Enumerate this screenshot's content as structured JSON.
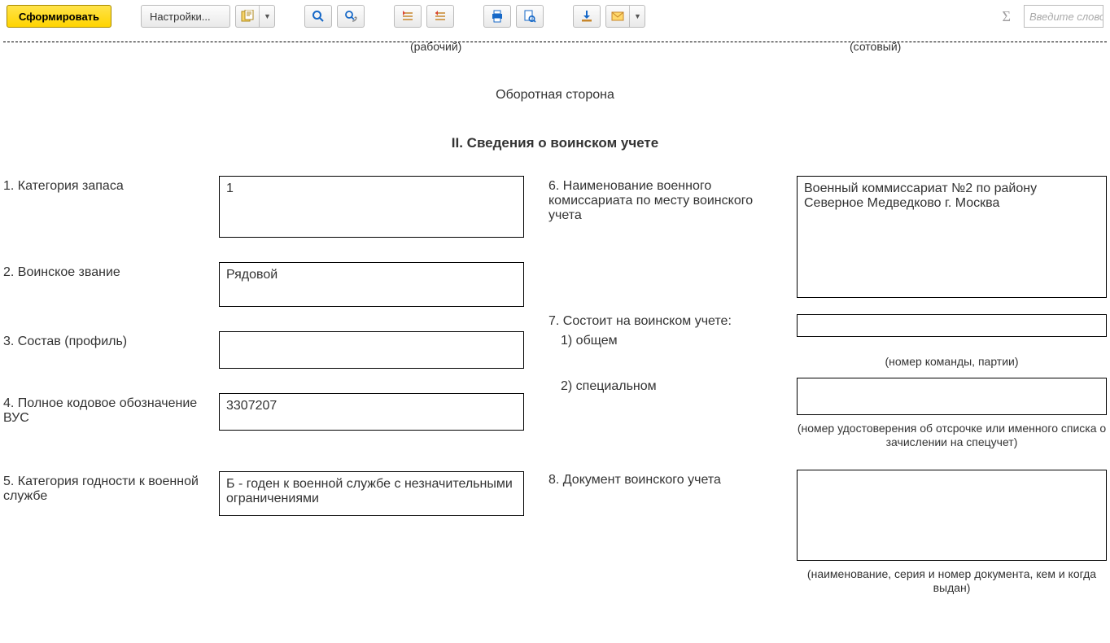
{
  "toolbar": {
    "generate_label": "Сформировать",
    "settings_label": "Настройки..."
  },
  "search_placeholder": "Введите слово",
  "phones": {
    "work": "(рабочий)",
    "mobile": "(сотовый)"
  },
  "page_title": "Оборотная сторона",
  "section_title": "II. Сведения о воинском учете",
  "left": {
    "f1_label": "1. Категория запаса",
    "f1_value": "1",
    "f2_label": "2. Воинское звание",
    "f2_value": "Рядовой",
    "f3_label": "3. Состав (профиль)",
    "f3_value": "",
    "f4_label": "4. Полное кодовое обозначение ВУС",
    "f4_value": "3307207",
    "f5_label": "5. Категория годности к военной службе",
    "f5_value": "Б - годен к военной службе с незначительными ограничениями"
  },
  "right": {
    "f6_label": "6. Наименование военного комиссариата по месту воинского учета",
    "f6_value": "Военный коммиссариат №2 по району Северное Медведково г. Москва",
    "f7_label": "7. Состоит на воинском учете:",
    "f7_sub1": "1) общем",
    "f7_cap1": "(номер команды, партии)",
    "f7_sub2": "2) специальном",
    "f7_cap2": "(номер удостоверения об отсрочке или именного списка о зачислении на спецучет)",
    "f8_label": "8. Документ воинского учета",
    "f8_value": "",
    "f8_cap": "(наименование, серия и номер документа, кем и когда выдан)"
  }
}
